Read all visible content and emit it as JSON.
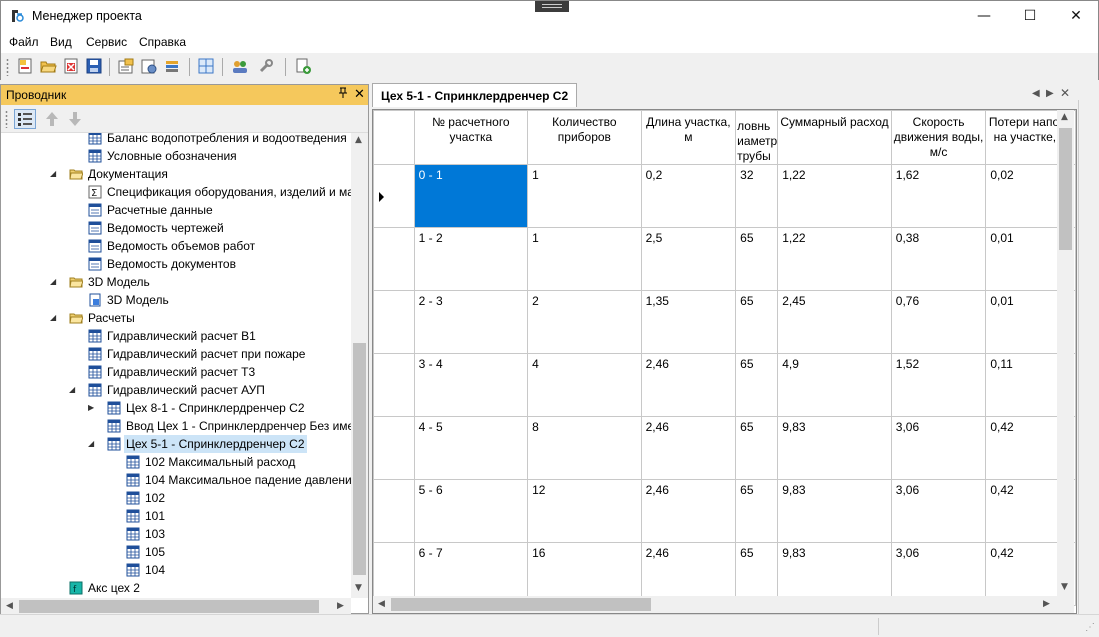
{
  "window": {
    "title": "Менеджер проекта",
    "minimize": "—",
    "maximize": "☐",
    "close": "✕"
  },
  "menu": [
    "Файл",
    "Вид",
    "Сервис",
    "Справка"
  ],
  "explorer": {
    "title": "Проводник",
    "pin": "📌",
    "close": "✕",
    "tree": [
      {
        "level": 2,
        "icon": "table-icon",
        "expander": "",
        "label": "Баланс водопотребления и водоотведения"
      },
      {
        "level": 2,
        "icon": "table-icon",
        "expander": "",
        "label": "Условные обозначения"
      },
      {
        "level": 1,
        "icon": "folder-icon",
        "expander": "◢",
        "label": "Документация"
      },
      {
        "level": 2,
        "icon": "sigma-icon",
        "expander": "",
        "label": "Спецификация оборудования, изделий и ма"
      },
      {
        "level": 2,
        "icon": "document-icon",
        "expander": "",
        "label": "Расчетные данные"
      },
      {
        "level": 2,
        "icon": "document-icon",
        "expander": "",
        "label": "Ведомость чертежей"
      },
      {
        "level": 2,
        "icon": "document-icon",
        "expander": "",
        "label": "Ведомость объемов работ"
      },
      {
        "level": 2,
        "icon": "document-icon",
        "expander": "",
        "label": "Ведомость документов"
      },
      {
        "level": 1,
        "icon": "folder-icon",
        "expander": "◢",
        "label": "3D Модель"
      },
      {
        "level": 2,
        "icon": "cube-icon",
        "expander": "",
        "label": "3D Модель"
      },
      {
        "level": 1,
        "icon": "folder-icon",
        "expander": "◢",
        "label": "Расчеты"
      },
      {
        "level": 2,
        "icon": "table-icon",
        "expander": "",
        "label": "Гидравлический расчет В1"
      },
      {
        "level": 2,
        "icon": "table-icon",
        "expander": "",
        "label": "Гидравлический расчет при пожаре"
      },
      {
        "level": 2,
        "icon": "table-icon",
        "expander": "",
        "label": "Гидравлический расчет Т3"
      },
      {
        "level": 2,
        "icon": "table-icon",
        "expander": "◢",
        "label": "Гидравлический расчет АУП"
      },
      {
        "level": 3,
        "icon": "table-icon",
        "expander": "▶",
        "label": "Цех 8-1 - Спринклердренчер С2"
      },
      {
        "level": 3,
        "icon": "table-icon",
        "expander": "",
        "label": "Ввод Цех 1 - Спринклердренчер Без име"
      },
      {
        "level": 3,
        "icon": "table-icon",
        "expander": "◢",
        "label": "Цех 5-1 - Спринклердренчер С2",
        "selected": true
      },
      {
        "level": 4,
        "icon": "table-icon",
        "expander": "",
        "label": "102 Максимальный расход"
      },
      {
        "level": 4,
        "icon": "table-icon",
        "expander": "",
        "label": "104 Максимальное падение давлени"
      },
      {
        "level": 4,
        "icon": "table-icon",
        "expander": "",
        "label": "102"
      },
      {
        "level": 4,
        "icon": "table-icon",
        "expander": "",
        "label": "101"
      },
      {
        "level": 4,
        "icon": "table-icon",
        "expander": "",
        "label": "103"
      },
      {
        "level": 4,
        "icon": "table-icon",
        "expander": "",
        "label": "105"
      },
      {
        "level": 4,
        "icon": "table-icon",
        "expander": "",
        "label": "104"
      },
      {
        "level": 0,
        "icon": "axis-icon",
        "expander": "",
        "label": "Акс цех 2"
      }
    ]
  },
  "document": {
    "tab_label": "Цех 5-1 - Спринклердренчер С2",
    "columns": [
      "№ расчетного участка",
      "Количество приборов",
      "Длина участка, м",
      "ловнь\nиаметр\nтрубы",
      "Суммарный расход",
      "Скорость движения воды, м/с",
      "Потери напора на участке, м"
    ],
    "rows": [
      [
        "0 - 1",
        "1",
        "0,2",
        "32",
        "1,22",
        "1,62",
        "0,02"
      ],
      [
        "1 - 2",
        "1",
        "2,5",
        "65",
        "1,22",
        "0,38",
        "0,01"
      ],
      [
        "2 - 3",
        "2",
        "1,35",
        "65",
        "2,45",
        "0,76",
        "0,01"
      ],
      [
        "3 - 4",
        "4",
        "2,46",
        "65",
        "4,9",
        "1,52",
        "0,11"
      ],
      [
        "4 - 5",
        "8",
        "2,46",
        "65",
        "9,83",
        "3,06",
        "0,42"
      ],
      [
        "5 - 6",
        "12",
        "2,46",
        "65",
        "9,83",
        "3,06",
        "0,42"
      ],
      [
        "6 - 7",
        "16",
        "2,46",
        "65",
        "9,83",
        "3,06",
        "0,42"
      ]
    ]
  },
  "colors": {
    "explorer_header": "#f5c85c",
    "selected_cell": "#0078d7",
    "selected_tree": "#cce4f7"
  }
}
